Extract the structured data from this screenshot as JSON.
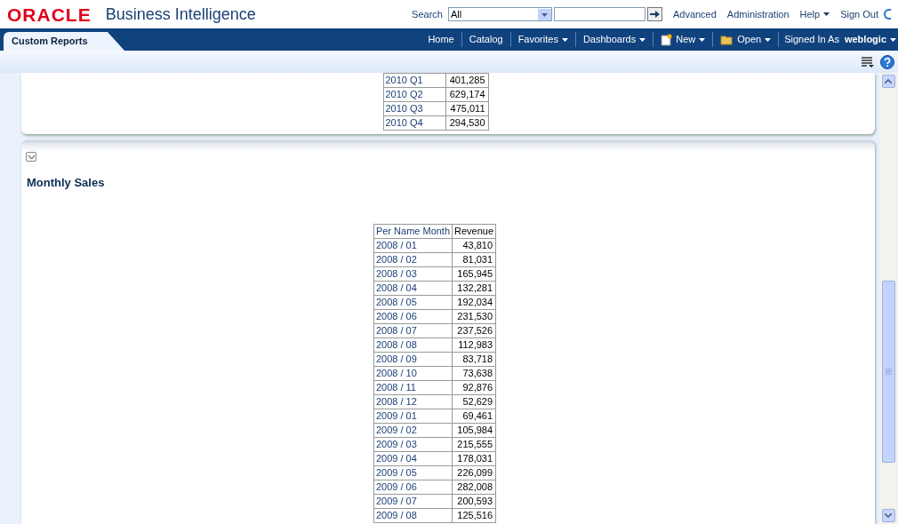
{
  "header": {
    "logo": "ORACLE",
    "product": "Business Intelligence",
    "search_label": "Search",
    "search_scope": "All",
    "links": [
      "Advanced",
      "Administration",
      "Help",
      "Sign Out"
    ]
  },
  "nav": {
    "tab": "Custom Reports",
    "items": [
      {
        "label": "Home",
        "kind": "link"
      },
      {
        "label": "Catalog",
        "kind": "link"
      },
      {
        "label": "Favorites",
        "kind": "menu"
      },
      {
        "label": "Dashboards",
        "kind": "menu"
      },
      {
        "label": "New",
        "kind": "new"
      },
      {
        "label": "Open",
        "kind": "open"
      }
    ],
    "signed_in_label": "Signed In As",
    "user": "weblogic"
  },
  "quarter_table": {
    "rows": [
      {
        "period": "2010 Q1",
        "revenue": "401,285"
      },
      {
        "period": "2010 Q2",
        "revenue": "629,174"
      },
      {
        "period": "2010 Q3",
        "revenue": "475,011"
      },
      {
        "period": "2010 Q4",
        "revenue": "294,530"
      }
    ]
  },
  "monthly_section": {
    "title": "Monthly Sales",
    "columns": [
      "Per Name Month",
      "Revenue"
    ],
    "rows": [
      {
        "period": "2008 / 01",
        "revenue": "43,810"
      },
      {
        "period": "2008 / 02",
        "revenue": "81,031"
      },
      {
        "period": "2008 / 03",
        "revenue": "165,945"
      },
      {
        "period": "2008 / 04",
        "revenue": "132,281"
      },
      {
        "period": "2008 / 05",
        "revenue": "192,034"
      },
      {
        "period": "2008 / 06",
        "revenue": "231,530"
      },
      {
        "period": "2008 / 07",
        "revenue": "237,526"
      },
      {
        "period": "2008 / 08",
        "revenue": "112,983"
      },
      {
        "period": "2008 / 09",
        "revenue": "83,718"
      },
      {
        "period": "2008 / 10",
        "revenue": "73,638"
      },
      {
        "period": "2008 / 11",
        "revenue": "92,876"
      },
      {
        "period": "2008 / 12",
        "revenue": "52,629"
      },
      {
        "period": "2009 / 01",
        "revenue": "69,461"
      },
      {
        "period": "2009 / 02",
        "revenue": "105,984"
      },
      {
        "period": "2009 / 03",
        "revenue": "215,555"
      },
      {
        "period": "2009 / 04",
        "revenue": "178,031"
      },
      {
        "period": "2009 / 05",
        "revenue": "226,099"
      },
      {
        "period": "2009 / 06",
        "revenue": "282,008"
      },
      {
        "period": "2009 / 07",
        "revenue": "200,593"
      },
      {
        "period": "2009 / 08",
        "revenue": "125,516"
      }
    ]
  }
}
